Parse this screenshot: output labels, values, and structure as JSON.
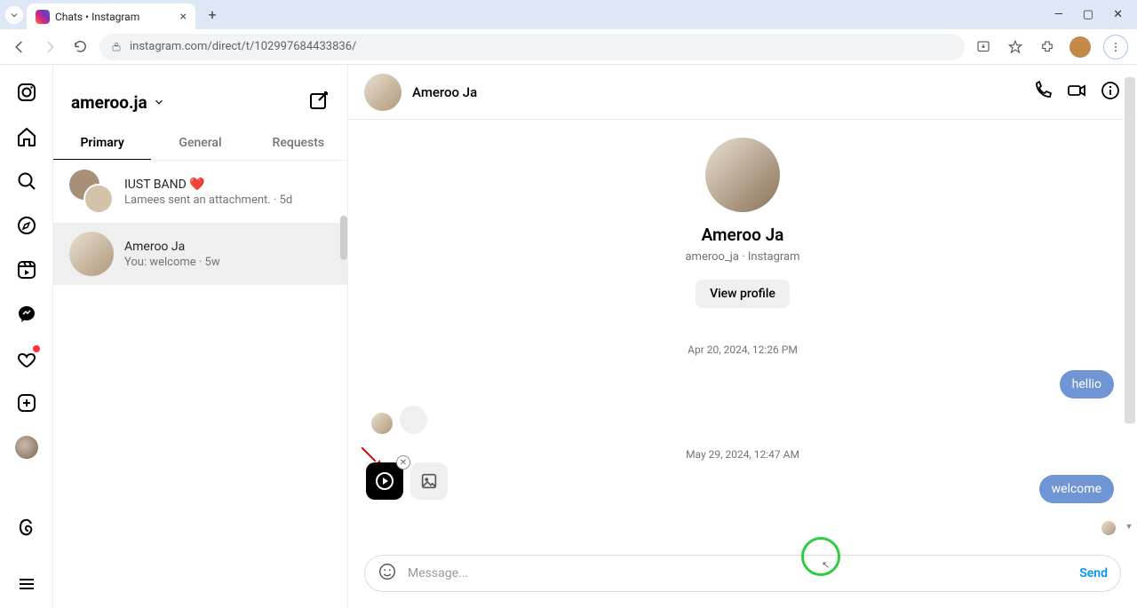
{
  "browser": {
    "tab_title": "Chats • Instagram",
    "url": "instagram.com/direct/t/102997684433836/"
  },
  "account": {
    "username": "ameroo.ja"
  },
  "tabs": {
    "primary": "Primary",
    "general": "General",
    "requests": "Requests"
  },
  "conversations": [
    {
      "name": "IUST BAND ❤️",
      "preview": "Lamees sent an attachment. · 5d"
    },
    {
      "name": "Ameroo Ja",
      "preview": "You: welcome · 5w"
    }
  ],
  "chat_header": {
    "name": "Ameroo Ja"
  },
  "profile": {
    "name": "Ameroo Ja",
    "handle": "ameroo_ja · Instagram",
    "view_profile": "View profile"
  },
  "timeline": {
    "ts1": "Apr 20, 2024, 12:26 PM",
    "msg1": "hellio",
    "ts2": "May 29, 2024, 12:47 AM",
    "msg2": "welcome"
  },
  "composer": {
    "placeholder": "Message...",
    "send": "Send"
  }
}
